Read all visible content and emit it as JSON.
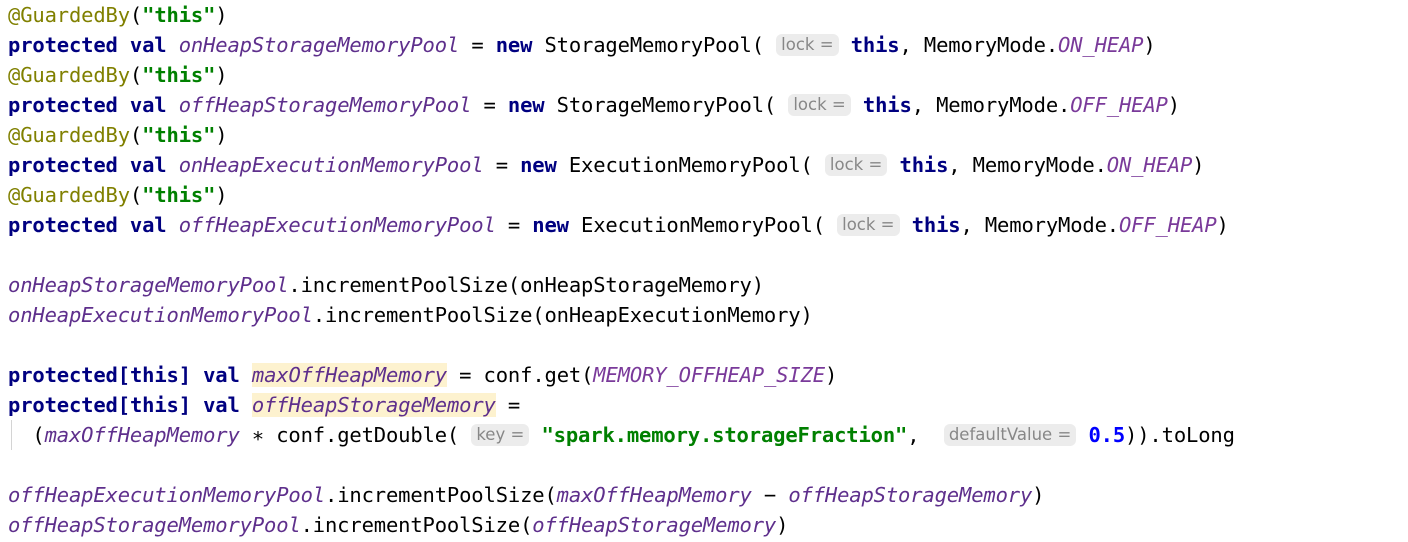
{
  "editor": {
    "language": "Scala",
    "theme": "IntelliJ Light",
    "colors": {
      "background": "#ffffff",
      "keyword": "#000080",
      "annotation": "#808000",
      "string": "#008000",
      "number": "#0000ff",
      "field": "#5e2f8c",
      "constant": "#7a3a9a",
      "plain_text": "#000000",
      "inlay_hint_text": "#878787",
      "inlay_hint_background": "#ececec",
      "identifier_highlight": "#fdf2cf",
      "indent_guide": "#d4d4d4"
    },
    "lines": [
      {
        "id": "line-1",
        "tokens": [
          {
            "t": "@GuardedBy",
            "c": "anno"
          },
          {
            "t": "(",
            "c": "plain"
          },
          {
            "t": "\"this\"",
            "c": "str"
          },
          {
            "t": ")",
            "c": "plain"
          }
        ]
      },
      {
        "id": "line-2",
        "tokens": [
          {
            "t": "protected val ",
            "c": "kw"
          },
          {
            "t": "onHeapStorageMemoryPool",
            "c": "field"
          },
          {
            "t": " = ",
            "c": "plain"
          },
          {
            "t": "new",
            "c": "kw"
          },
          {
            "t": " StorageMemoryPool(",
            "c": "plain"
          },
          {
            "t": " ",
            "c": "plain"
          },
          {
            "t": "lock =",
            "c": "hint"
          },
          {
            "t": " ",
            "c": "plain"
          },
          {
            "t": "this",
            "c": "kw"
          },
          {
            "t": ", MemoryMode.",
            "c": "plain"
          },
          {
            "t": "ON_HEAP",
            "c": "const"
          },
          {
            "t": ")",
            "c": "plain"
          }
        ]
      },
      {
        "id": "line-3",
        "tokens": [
          {
            "t": "@GuardedBy",
            "c": "anno"
          },
          {
            "t": "(",
            "c": "plain"
          },
          {
            "t": "\"this\"",
            "c": "str"
          },
          {
            "t": ")",
            "c": "plain"
          }
        ]
      },
      {
        "id": "line-4",
        "tokens": [
          {
            "t": "protected val ",
            "c": "kw"
          },
          {
            "t": "offHeapStorageMemoryPool",
            "c": "field"
          },
          {
            "t": " = ",
            "c": "plain"
          },
          {
            "t": "new",
            "c": "kw"
          },
          {
            "t": " StorageMemoryPool(",
            "c": "plain"
          },
          {
            "t": " ",
            "c": "plain"
          },
          {
            "t": "lock =",
            "c": "hint"
          },
          {
            "t": " ",
            "c": "plain"
          },
          {
            "t": "this",
            "c": "kw"
          },
          {
            "t": ", MemoryMode.",
            "c": "plain"
          },
          {
            "t": "OFF_HEAP",
            "c": "const"
          },
          {
            "t": ")",
            "c": "plain"
          }
        ]
      },
      {
        "id": "line-5",
        "tokens": [
          {
            "t": "@GuardedBy",
            "c": "anno"
          },
          {
            "t": "(",
            "c": "plain"
          },
          {
            "t": "\"this\"",
            "c": "str"
          },
          {
            "t": ")",
            "c": "plain"
          }
        ]
      },
      {
        "id": "line-6",
        "tokens": [
          {
            "t": "protected val ",
            "c": "kw"
          },
          {
            "t": "onHeapExecutionMemoryPool",
            "c": "field"
          },
          {
            "t": " = ",
            "c": "plain"
          },
          {
            "t": "new",
            "c": "kw"
          },
          {
            "t": " ExecutionMemoryPool(",
            "c": "plain"
          },
          {
            "t": " ",
            "c": "plain"
          },
          {
            "t": "lock =",
            "c": "hint"
          },
          {
            "t": " ",
            "c": "plain"
          },
          {
            "t": "this",
            "c": "kw"
          },
          {
            "t": ", MemoryMode.",
            "c": "plain"
          },
          {
            "t": "ON_HEAP",
            "c": "const"
          },
          {
            "t": ")",
            "c": "plain"
          }
        ]
      },
      {
        "id": "line-7",
        "tokens": [
          {
            "t": "@GuardedBy",
            "c": "anno"
          },
          {
            "t": "(",
            "c": "plain"
          },
          {
            "t": "\"this\"",
            "c": "str"
          },
          {
            "t": ")",
            "c": "plain"
          }
        ]
      },
      {
        "id": "line-8",
        "tokens": [
          {
            "t": "protected val ",
            "c": "kw"
          },
          {
            "t": "offHeapExecutionMemoryPool",
            "c": "field"
          },
          {
            "t": " = ",
            "c": "plain"
          },
          {
            "t": "new",
            "c": "kw"
          },
          {
            "t": " ExecutionMemoryPool(",
            "c": "plain"
          },
          {
            "t": " ",
            "c": "plain"
          },
          {
            "t": "lock =",
            "c": "hint"
          },
          {
            "t": " ",
            "c": "plain"
          },
          {
            "t": "this",
            "c": "kw"
          },
          {
            "t": ", MemoryMode.",
            "c": "plain"
          },
          {
            "t": "OFF_HEAP",
            "c": "const"
          },
          {
            "t": ")",
            "c": "plain"
          }
        ]
      },
      {
        "id": "line-9",
        "tokens": []
      },
      {
        "id": "line-10",
        "tokens": [
          {
            "t": "onHeapStorageMemoryPool",
            "c": "field"
          },
          {
            "t": ".incrementPoolSize(onHeapStorageMemory)",
            "c": "plain"
          }
        ]
      },
      {
        "id": "line-11",
        "tokens": [
          {
            "t": "onHeapExecutionMemoryPool",
            "c": "field"
          },
          {
            "t": ".incrementPoolSize(onHeapExecutionMemory)",
            "c": "plain"
          }
        ]
      },
      {
        "id": "line-12",
        "tokens": []
      },
      {
        "id": "line-13",
        "tokens": [
          {
            "t": "protected",
            "c": "kw"
          },
          {
            "t": "[",
            "c": "kw"
          },
          {
            "t": "this",
            "c": "kw"
          },
          {
            "t": "] ",
            "c": "kw"
          },
          {
            "t": "val ",
            "c": "kw"
          },
          {
            "t": "maxOffHeapMemory",
            "c": "field hl"
          },
          {
            "t": " = conf.get(",
            "c": "plain"
          },
          {
            "t": "MEMORY_OFFHEAP_SIZE",
            "c": "const"
          },
          {
            "t": ")",
            "c": "plain"
          }
        ]
      },
      {
        "id": "line-14",
        "tokens": [
          {
            "t": "protected",
            "c": "kw"
          },
          {
            "t": "[",
            "c": "kw"
          },
          {
            "t": "this",
            "c": "kw"
          },
          {
            "t": "] ",
            "c": "kw"
          },
          {
            "t": "val ",
            "c": "kw"
          },
          {
            "t": "offHeapStorageMemory",
            "c": "field hl"
          },
          {
            "t": " =",
            "c": "plain"
          }
        ]
      },
      {
        "id": "line-15",
        "indent_guide": true,
        "tokens": [
          {
            "t": "  (",
            "c": "plain"
          },
          {
            "t": "maxOffHeapMemory",
            "c": "field"
          },
          {
            "t": " ∗ conf.getDouble(",
            "c": "plain"
          },
          {
            "t": " ",
            "c": "plain"
          },
          {
            "t": "key =",
            "c": "hint"
          },
          {
            "t": " ",
            "c": "plain"
          },
          {
            "t": "\"spark.memory.storageFraction\"",
            "c": "str"
          },
          {
            "t": ",  ",
            "c": "plain"
          },
          {
            "t": "defaultValue =",
            "c": "hint"
          },
          {
            "t": " ",
            "c": "plain"
          },
          {
            "t": "0.5",
            "c": "num"
          },
          {
            "t": ")).toLong",
            "c": "plain"
          }
        ]
      },
      {
        "id": "line-16",
        "tokens": []
      },
      {
        "id": "line-17",
        "tokens": [
          {
            "t": "offHeapExecutionMemoryPool",
            "c": "field"
          },
          {
            "t": ".incrementPoolSize(",
            "c": "plain"
          },
          {
            "t": "maxOffHeapMemory",
            "c": "field"
          },
          {
            "t": " − ",
            "c": "plain"
          },
          {
            "t": "offHeapStorageMemory",
            "c": "field"
          },
          {
            "t": ")",
            "c": "plain"
          }
        ]
      },
      {
        "id": "line-18",
        "tokens": [
          {
            "t": "offHeapStorageMemoryPool",
            "c": "field"
          },
          {
            "t": ".incrementPoolSize(",
            "c": "plain"
          },
          {
            "t": "offHeapStorageMemory",
            "c": "field"
          },
          {
            "t": ")",
            "c": "plain"
          }
        ]
      }
    ]
  }
}
